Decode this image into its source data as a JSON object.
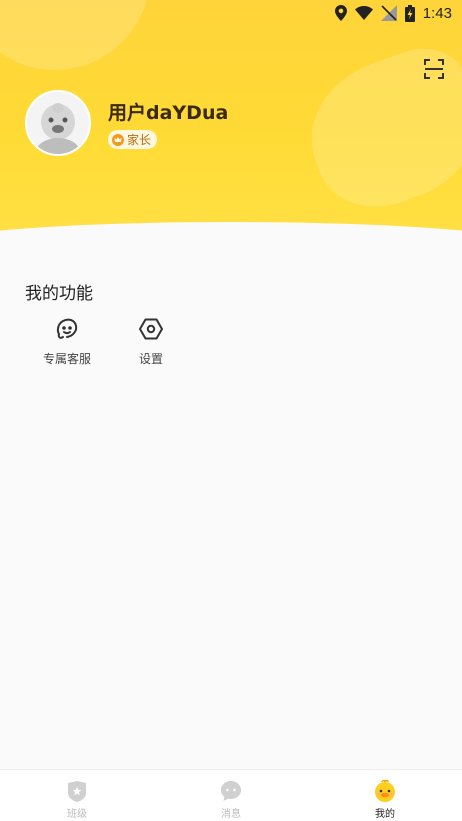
{
  "status_bar": {
    "time": "1:43"
  },
  "profile": {
    "username": "用户daYDua",
    "role": "家长"
  },
  "functions": {
    "title": "我的功能",
    "items": [
      {
        "label": "专属客服",
        "icon": "customer-service-icon"
      },
      {
        "label": "设置",
        "icon": "settings-icon"
      }
    ]
  },
  "tabbar": {
    "items": [
      {
        "label": "班级",
        "icon": "class-icon",
        "active": false
      },
      {
        "label": "消息",
        "icon": "message-icon",
        "active": false
      },
      {
        "label": "我的",
        "icon": "duck-icon",
        "active": true
      }
    ]
  },
  "colors": {
    "brand_yellow": "#ffd93a",
    "badge_orange": "#f39a1a"
  }
}
